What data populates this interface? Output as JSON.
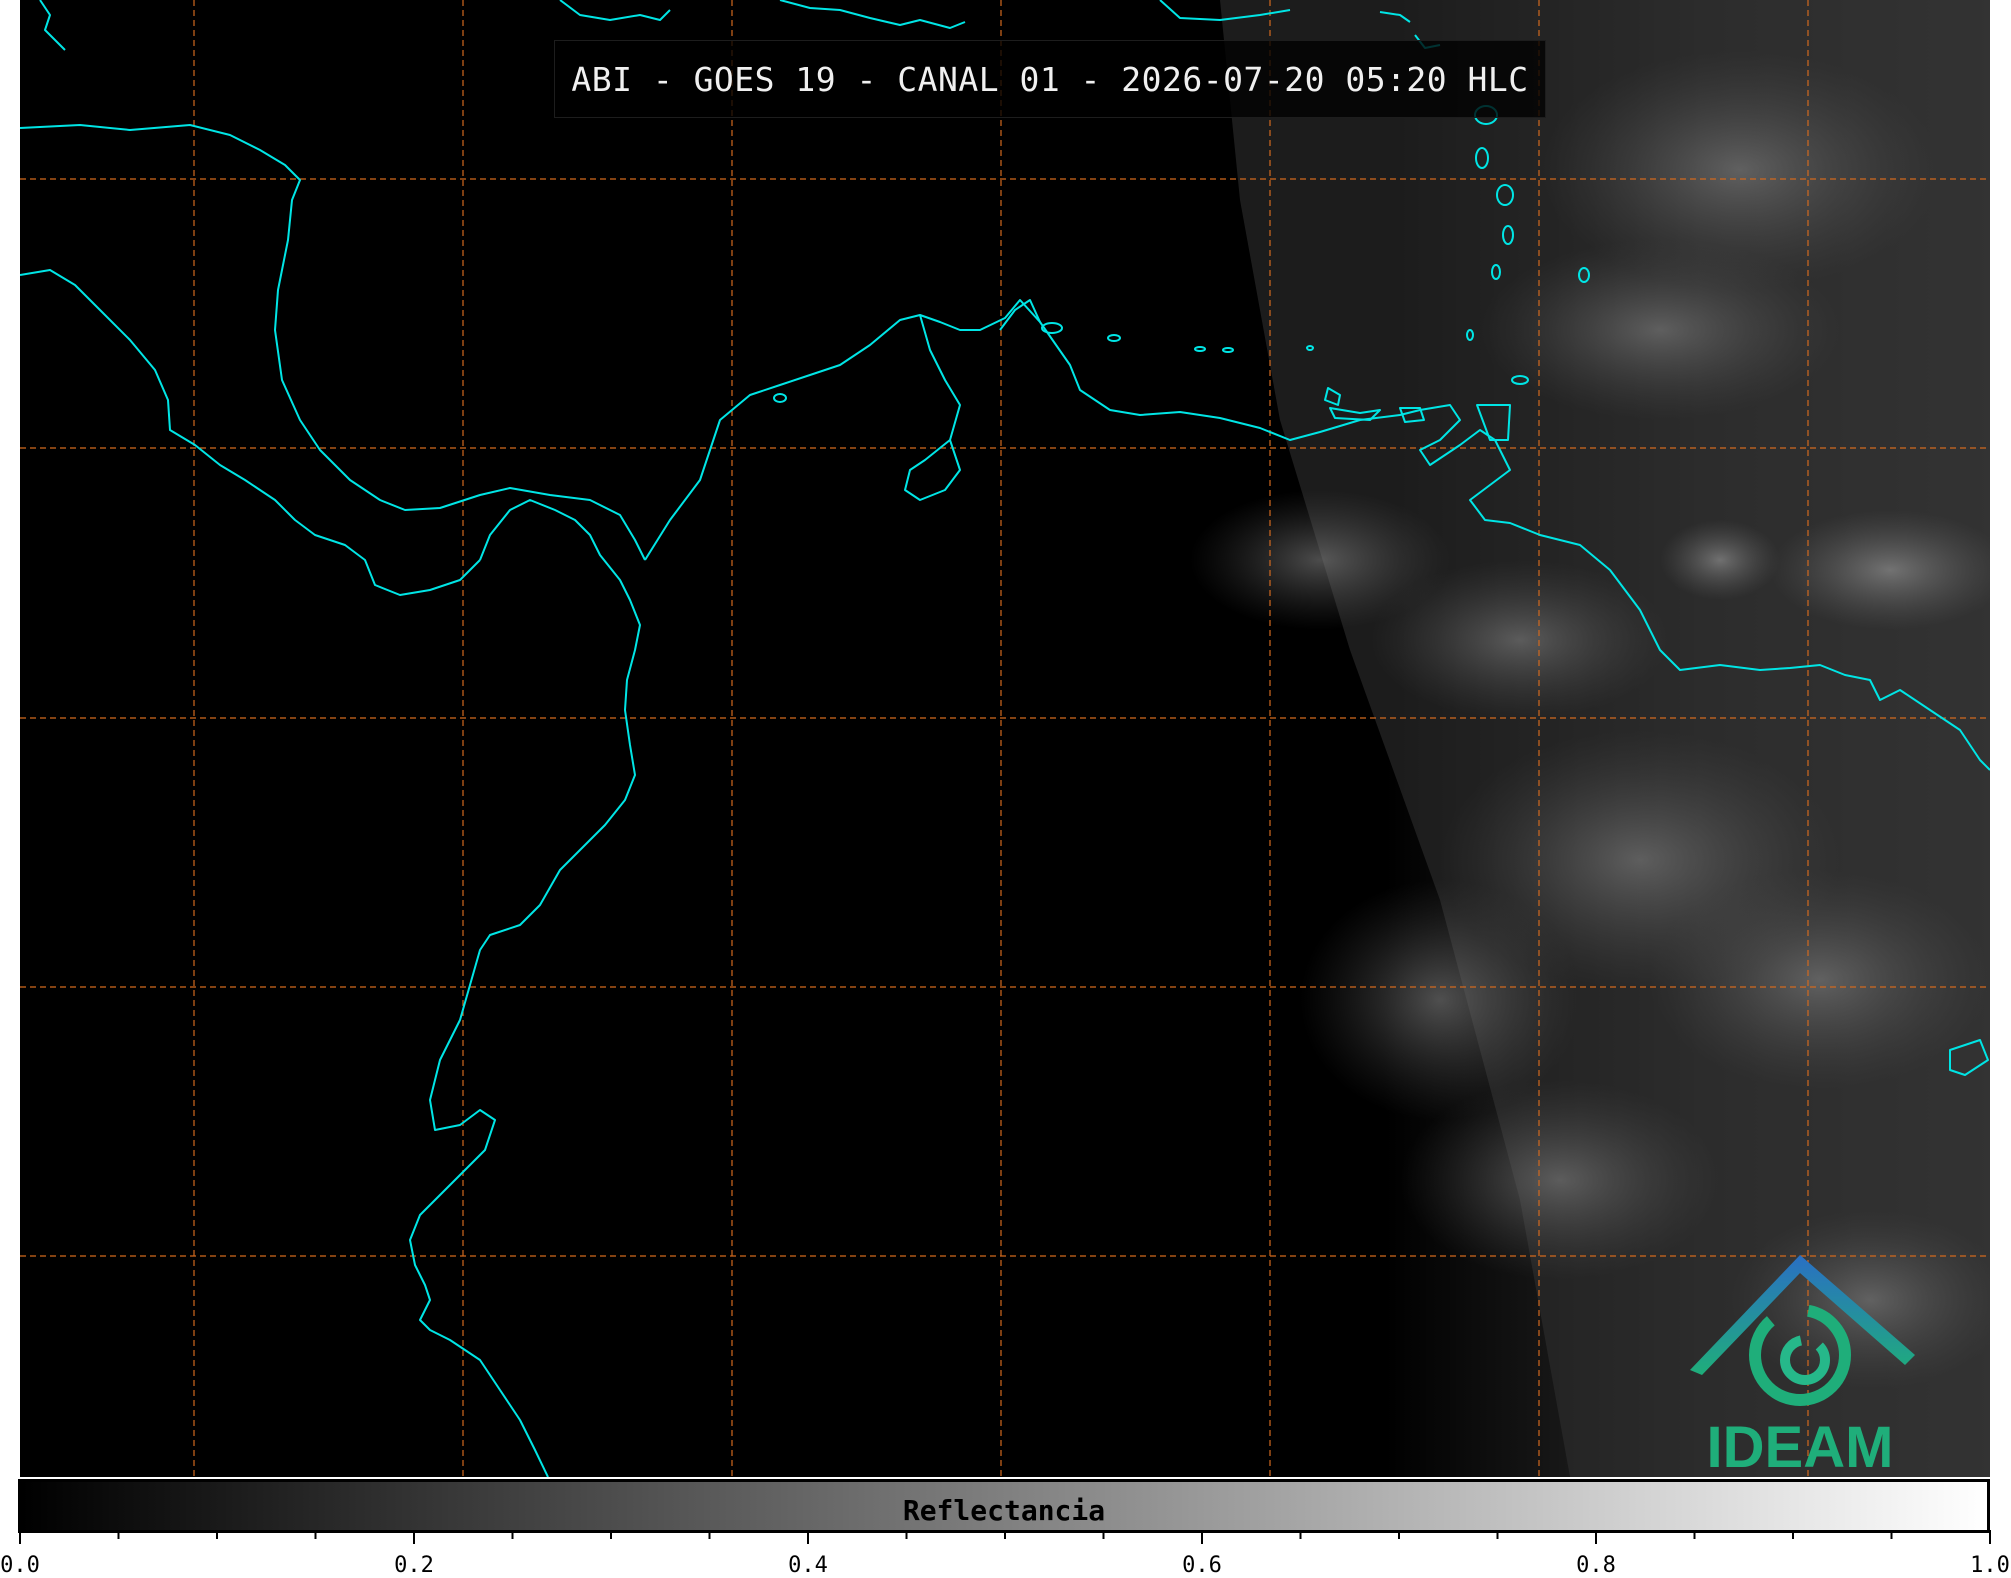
{
  "title": "ABI - GOES 19 - CANAL 01 - 2026-07-20 05:20 HLC",
  "colorbar": {
    "label": "Reflectancia",
    "min": 0.0,
    "max": 1.0,
    "major_ticks": [
      "0.0",
      "0.2",
      "0.4",
      "0.6",
      "0.8",
      "1.0"
    ],
    "minor_step": 0.05
  },
  "logo": {
    "text": "IDEAM",
    "icon": "ideam-swirl-mountain-logo"
  },
  "colors": {
    "coastline": "#00e5e5",
    "gridline": "#d2691e",
    "logo_green": "#1fae7a",
    "logo_blue": "#2a7fc4"
  },
  "map": {
    "gridlines": true,
    "gridline_style": "dashed"
  }
}
